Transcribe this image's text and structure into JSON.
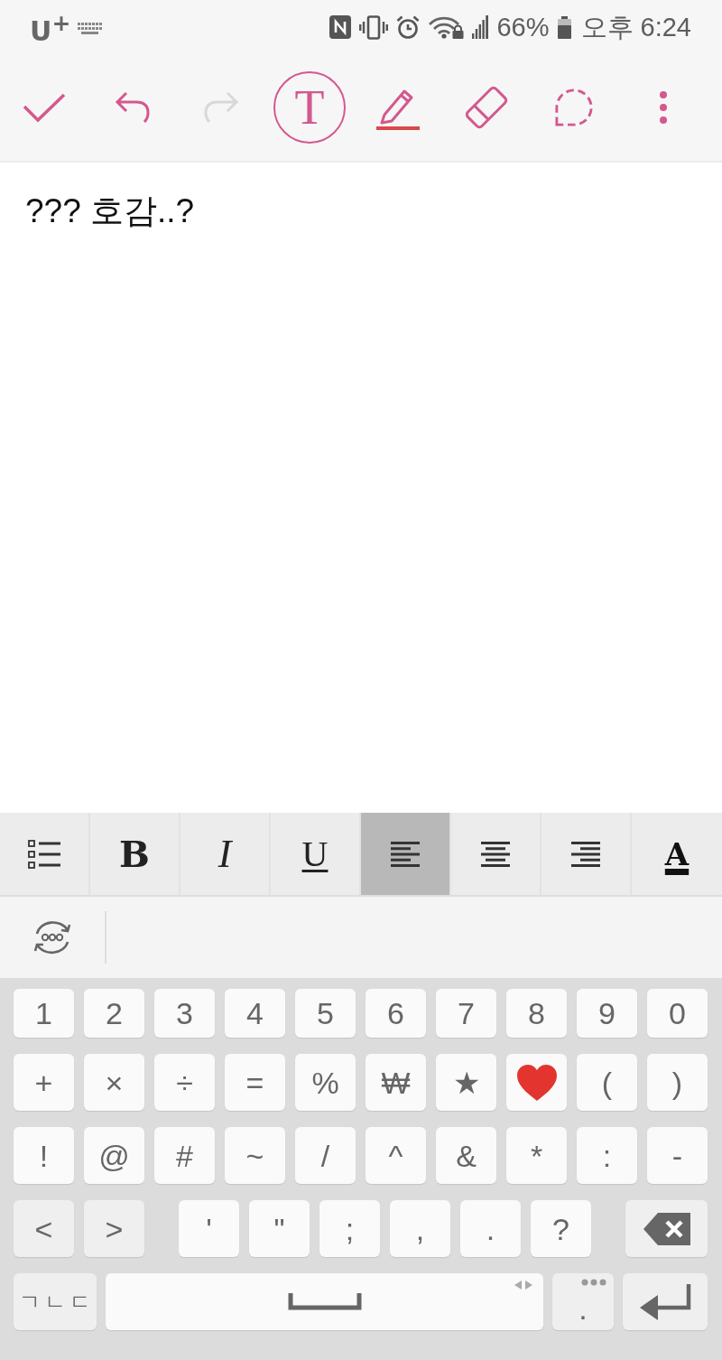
{
  "status_bar": {
    "carrier": "U$^{+}$",
    "battery": "66%",
    "time": "오후 6:24"
  },
  "toolbar": {
    "tools": [
      {
        "kind": "done",
        "selected": false,
        "disabled": false
      },
      {
        "kind": "undo",
        "selected": false,
        "disabled": false
      },
      {
        "kind": "redo",
        "selected": false,
        "disabled": true
      },
      {
        "kind": "text",
        "label": "T",
        "selected": true,
        "disabled": false
      },
      {
        "kind": "pen",
        "selected": false,
        "disabled": false
      },
      {
        "kind": "eraser",
        "selected": false,
        "disabled": false
      },
      {
        "kind": "lasso",
        "selected": false,
        "disabled": false
      },
      {
        "kind": "more",
        "selected": false,
        "disabled": false
      }
    ]
  },
  "note": {
    "text": "??? 호감..?"
  },
  "format_bar": {
    "items": [
      {
        "kind": "list",
        "selected": false
      },
      {
        "kind": "bold",
        "label": "B",
        "selected": false
      },
      {
        "kind": "italic",
        "label": "I",
        "selected": false
      },
      {
        "kind": "underline",
        "label": "U",
        "selected": false
      },
      {
        "kind": "align_left",
        "selected": true
      },
      {
        "kind": "align_center",
        "selected": false
      },
      {
        "kind": "align_right",
        "selected": false
      },
      {
        "kind": "text_color",
        "label": "A",
        "selected": false
      }
    ]
  },
  "keyboard": {
    "rows": [
      [
        {
          "kind": "char",
          "label": "1"
        },
        {
          "kind": "char",
          "label": "2"
        },
        {
          "kind": "char",
          "label": "3"
        },
        {
          "kind": "char",
          "label": "4"
        },
        {
          "kind": "char",
          "label": "5"
        },
        {
          "kind": "char",
          "label": "6"
        },
        {
          "kind": "char",
          "label": "7"
        },
        {
          "kind": "char",
          "label": "8"
        },
        {
          "kind": "char",
          "label": "9"
        },
        {
          "kind": "char",
          "label": "0"
        }
      ],
      [
        {
          "kind": "char",
          "label": "+"
        },
        {
          "kind": "char",
          "label": "×"
        },
        {
          "kind": "char",
          "label": "÷"
        },
        {
          "kind": "char",
          "label": "="
        },
        {
          "kind": "char",
          "label": "%"
        },
        {
          "kind": "char",
          "label": "₩"
        },
        {
          "kind": "char",
          "label": "★"
        },
        {
          "kind": "heart"
        },
        {
          "kind": "char",
          "label": "("
        },
        {
          "kind": "char",
          "label": ")"
        }
      ],
      [
        {
          "kind": "char",
          "label": "!"
        },
        {
          "kind": "char",
          "label": "@"
        },
        {
          "kind": "char",
          "label": "#"
        },
        {
          "kind": "char",
          "label": "~"
        },
        {
          "kind": "char",
          "label": "/"
        },
        {
          "kind": "char",
          "label": "^"
        },
        {
          "kind": "char",
          "label": "&"
        },
        {
          "kind": "char",
          "label": "*"
        },
        {
          "kind": "char",
          "label": ":"
        },
        {
          "kind": "char",
          "label": "-"
        }
      ],
      [
        {
          "kind": "func",
          "label": "<"
        },
        {
          "kind": "func",
          "label": ">"
        },
        {
          "kind": "char",
          "label": "'"
        },
        {
          "kind": "char",
          "label": "\""
        },
        {
          "kind": "char",
          "label": ";"
        },
        {
          "kind": "char",
          "label": ","
        },
        {
          "kind": "char",
          "label": "."
        },
        {
          "kind": "char",
          "label": "?"
        },
        {
          "kind": "backspace"
        }
      ],
      [
        {
          "kind": "mode",
          "label": "ㄱㄴㄷ"
        },
        {
          "kind": "space"
        },
        {
          "kind": "period",
          "label": "."
        },
        {
          "kind": "enter"
        }
      ]
    ]
  }
}
